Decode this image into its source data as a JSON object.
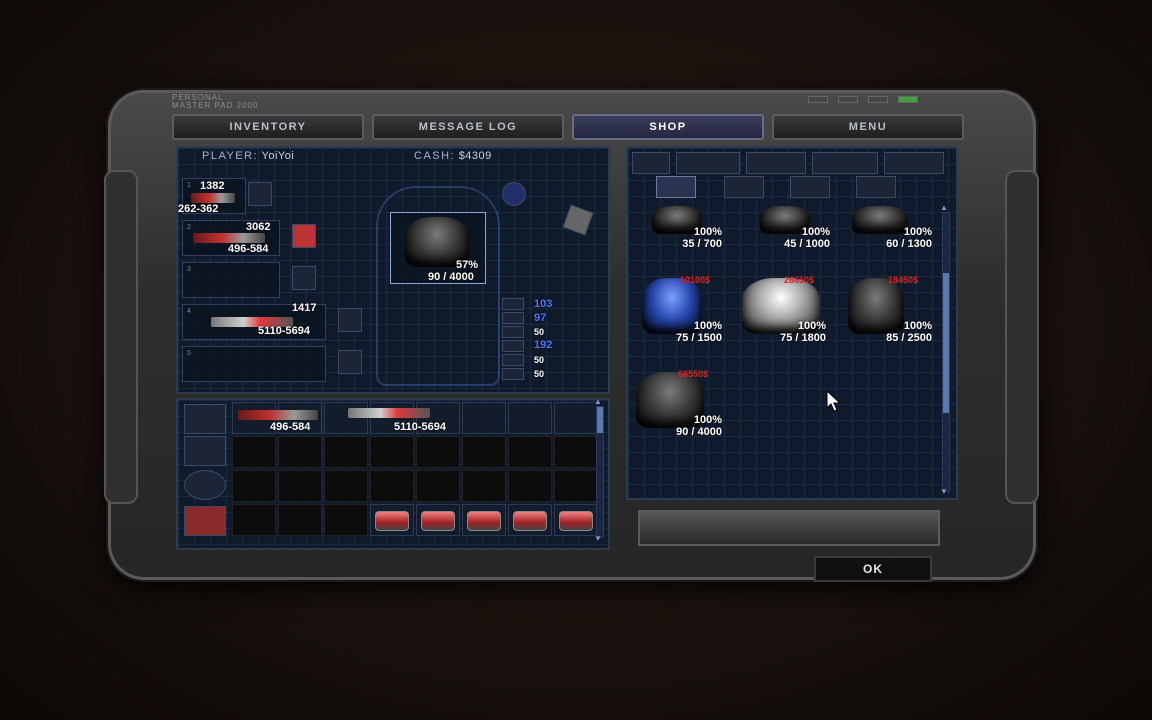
{
  "brand": {
    "line1": "PERSONAL",
    "line2": "MASTER PAD 2000"
  },
  "tabs": [
    {
      "label": "INVENTORY",
      "active": false
    },
    {
      "label": "MESSAGE LOG",
      "active": false
    },
    {
      "label": "SHOP",
      "active": true
    },
    {
      "label": "MENU",
      "active": false
    }
  ],
  "player": {
    "label": "PLAYER:",
    "name": "YoiYoi",
    "cash_label": "CASH:",
    "cash": "$4309"
  },
  "loadout": {
    "slot1": {
      "n": "1",
      "ammo": "1382",
      "damage": "262-362"
    },
    "slot2": {
      "n": "2",
      "ammo": "3062",
      "damage": "496-584"
    },
    "slot3": {
      "n": "3"
    },
    "slot4": {
      "n": "4",
      "ammo": "1417",
      "damage": "5110-5694"
    },
    "slot5": {
      "n": "5"
    }
  },
  "armor_equipped": {
    "percent": "57%",
    "hp": "90 / 4000"
  },
  "resources": [
    "103",
    "97",
    "50",
    "192",
    "50",
    "50"
  ],
  "backpack": {
    "items": [
      {
        "damage": "496-584"
      },
      {
        "damage": "5110-5694"
      }
    ]
  },
  "shop": {
    "items": [
      {
        "percent": "100%",
        "hp": "35 / 700",
        "price": ""
      },
      {
        "percent": "100%",
        "hp": "45 / 1000",
        "price": ""
      },
      {
        "percent": "100%",
        "hp": "60 / 1300",
        "price": ""
      },
      {
        "percent": "100%",
        "hp": "75 / 1500",
        "price": "10100$"
      },
      {
        "percent": "100%",
        "hp": "75 / 1800",
        "price": "26650$"
      },
      {
        "percent": "100%",
        "hp": "85 / 2500",
        "price": "18450$"
      },
      {
        "percent": "100%",
        "hp": "90 / 4000",
        "price": "66550$"
      }
    ]
  },
  "ok_label": "OK",
  "colors": {
    "accent": "#4a78ff",
    "price": "#e02020",
    "panel": "#0f1a2a"
  }
}
